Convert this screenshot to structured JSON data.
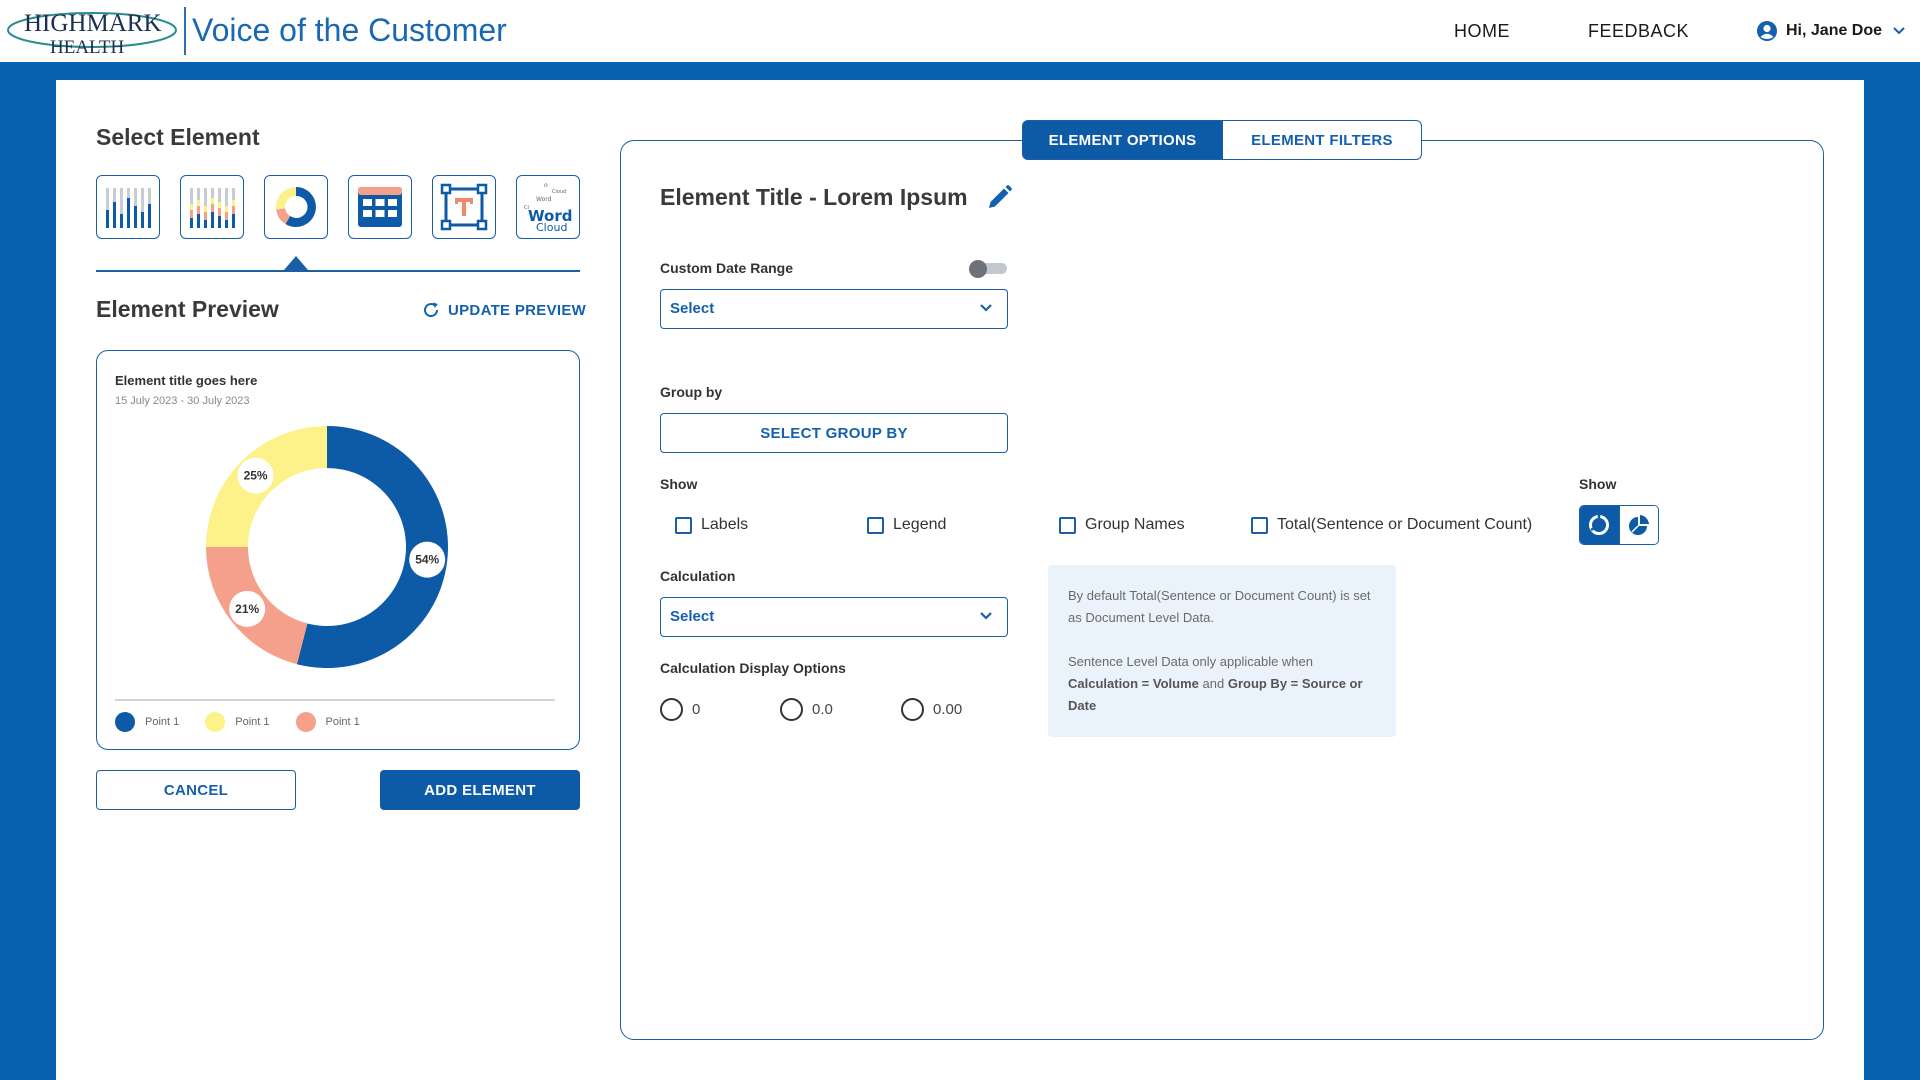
{
  "header": {
    "logo_line1": "HIGHMARK",
    "logo_line2": "HEALTH",
    "app_title": "Voice of the Customer",
    "nav": {
      "home": "HOME",
      "feedback": "FEEDBACK"
    },
    "user_greeting": "Hi, Jane Doe"
  },
  "left": {
    "select_element_title": "Select Element",
    "element_types": [
      "bar-chart-icon",
      "stacked-bar-chart-icon",
      "donut-chart-icon",
      "table-icon",
      "text-icon",
      "word-cloud-icon"
    ],
    "selected_element_index": 2,
    "word_cloud_label_1": "Word",
    "word_cloud_label_2": "Cloud",
    "preview_title": "Element Preview",
    "update_preview_label": "UPDATE PREVIEW",
    "preview_card": {
      "title": "Element title goes here",
      "date_range": "15 July 2023 - 30 July 2023"
    },
    "cancel_label": "CANCEL",
    "add_label": "ADD ELEMENT"
  },
  "chart_data": {
    "type": "pie",
    "variant": "donut",
    "title": "Element title goes here",
    "subtitle": "15 July 2023 - 30 July 2023",
    "slices": [
      {
        "label": "Point 1",
        "value": 54,
        "display": "54%",
        "color": "#0d5aa7"
      },
      {
        "label": "Point 1",
        "value": 21,
        "display": "21%",
        "color": "#f5a08a"
      },
      {
        "label": "Point 1",
        "value": 25,
        "display": "25%",
        "color": "#fdf18a"
      }
    ],
    "legend_placement": "bottom",
    "legend": [
      {
        "label": "Point 1",
        "color": "#0d5aa7"
      },
      {
        "label": "Point 1",
        "color": "#fdf18a"
      },
      {
        "label": "Point 1",
        "color": "#f5a08a"
      }
    ]
  },
  "right": {
    "tabs": [
      {
        "label": "ELEMENT OPTIONS",
        "active": true
      },
      {
        "label": "ELEMENT FILTERS",
        "active": false
      }
    ],
    "element_title": "Element Title - Lorem Ipsum",
    "custom_date_range_label": "Custom Date Range",
    "custom_date_range_on": false,
    "date_select_value": "Select",
    "group_by_label": "Group by",
    "group_by_button": "SELECT GROUP BY",
    "show_label": "Show",
    "show_options": [
      "Labels",
      "Legend",
      "Group Names",
      "Total(Sentence or Document Count)"
    ],
    "show_label_2": "Show",
    "calculation_label": "Calculation",
    "calculation_value": "Select",
    "info": {
      "line1": "By default Total(Sentence or Document Count) is set as Document Level Data.",
      "line2_prefix": "Sentence Level Data only applicable when",
      "line2_bold1": "Calculation = Volume",
      "line2_mid": "and",
      "line2_bold2": "Group By = Source or Date"
    },
    "calc_display_label": "Calculation Display Options",
    "calc_display_options": [
      "0",
      "0.0",
      "0.00"
    ]
  },
  "colors": {
    "brand_blue": "#0962b0",
    "accent": "#1560ad",
    "donut_blue": "#0d5aa7",
    "donut_yellow": "#fdf18a",
    "donut_salmon": "#f5a08a"
  }
}
